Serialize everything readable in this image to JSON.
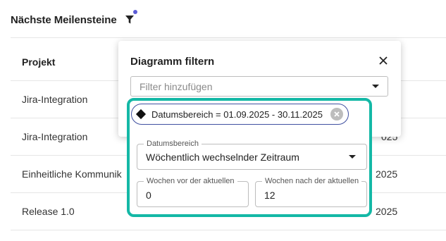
{
  "header": {
    "title": "Nächste Meilensteine",
    "filter_icon": "filter-icon",
    "indicator_color": "#5b5bd6"
  },
  "table": {
    "column_header": "Projekt",
    "rows": [
      {
        "project": "Jira-Integration",
        "date_fragment": ""
      },
      {
        "project": "Jira-Integration",
        "date_fragment": "025"
      },
      {
        "project": "Einheitliche Kommunik",
        "date_fragment": "2025"
      },
      {
        "project": "Release 1.0",
        "date_fragment": "2025"
      }
    ]
  },
  "popup": {
    "title": "Diagramm filtern",
    "close_icon": "close-icon",
    "add_filter_placeholder": "Filter hinzufügen",
    "chip": {
      "label": "Datumsbereich = 01.09.2025 - 30.11.2025",
      "border_color": "#3f4fa0"
    },
    "highlight_color": "#14b8a6",
    "date_range": {
      "label": "Datumsbereich",
      "value": "Wöchentlich wechselnder Zeitraum"
    },
    "weeks_before": {
      "label": "Wochen vor der aktuellen",
      "value": "0"
    },
    "weeks_after": {
      "label": "Wochen nach der aktuellen",
      "value": "12"
    }
  }
}
